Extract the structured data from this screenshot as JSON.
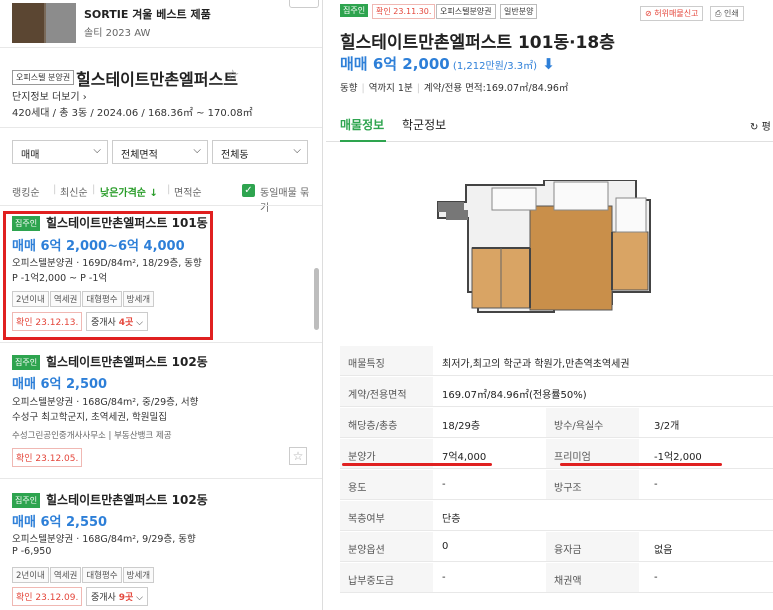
{
  "ad": {
    "title": "SORTIE 겨울 베스트 제품",
    "sub": "솔티 2023 AW"
  },
  "complex": {
    "tag": "오피스텔 분양권",
    "name": "힐스테이트만촌엘퍼스트",
    "link": "단지정보 더보기 ›",
    "info": "420세대 / 총 3동 / 2024.06 / 168.36㎡ ~ 170.08㎡"
  },
  "filters": [
    {
      "label": "매매"
    },
    {
      "label": "전체면적"
    },
    {
      "label": "전체동"
    }
  ],
  "sort": {
    "ranking": "랭킹순",
    "newest": "최신순",
    "lowprice": "낮은가격순 ↓",
    "area": "면적순",
    "group": "동일매물 묶기"
  },
  "listings": [
    {
      "badge": "집주인",
      "name": "힐스테이트만촌엘퍼스트 101동",
      "price": "매매 6억 2,000~6억 4,000",
      "line1": "오피스텔분양권 · 169D/84m², 18/29층, 동향",
      "line2": "P -1억2,000 ~ P -1억",
      "chips": [
        "2년이내",
        "역세권",
        "대형평수",
        "방세개"
      ],
      "confirm": "확인 23.12.13.",
      "agent_pre": "중개사 ",
      "agent_num": "4곳",
      "agent_post": " ⌵"
    },
    {
      "badge": "집주인",
      "name": "힐스테이트만촌엘퍼스트 102동",
      "price": "매매 6억 2,500",
      "line1": "오피스텔분양권 · 168G/84m², 중/29층, 서향",
      "line2": "수성구 최고학군지, 초역세권, 학원밀집",
      "line3": "수성그린공인중개사사무소 | 부동산뱅크 제공",
      "confirm": "확인 23.12.05."
    },
    {
      "badge": "집주인",
      "name": "힐스테이트만촌엘퍼스트 102동",
      "price": "매매 6억 2,550",
      "line1": "오피스텔분양권 · 168G/84m², 9/29층, 동향",
      "line2": "P -6,950",
      "chips": [
        "2년이내",
        "역세권",
        "대형평수",
        "방세개"
      ],
      "confirm": "확인 23.12.09.",
      "agent_pre": "중개사 ",
      "agent_num": "9곳",
      "agent_post": " ⌵"
    }
  ],
  "detail": {
    "badges": {
      "owner": "집주인",
      "confirm": "확인 23.11.30.",
      "type": "오피스텔분양권",
      "kind": "일반분양"
    },
    "report": "허위매물신고",
    "print": "인쇄",
    "title": "힐스테이트만촌엘퍼스트 101동·18층",
    "price": "매매 6억 2,000",
    "price_sub": " (1,212만원/3.3㎡)",
    "meta": [
      "동향",
      "역까지 1분",
      "계약/전용 면적:169.07㎡/84.96㎡"
    ],
    "tabs": [
      "매물정보",
      "학군정보"
    ],
    "refresh": "평",
    "table": [
      {
        "k": "매물특징",
        "v": "최저가,최고의 학군과 학원가,만촌역초역세권"
      },
      {
        "k": "계약/전용면적",
        "v": "169.07㎡/84.96㎡(전용률50%)"
      },
      {
        "k": "해당층/총층",
        "v": "18/29층",
        "k2": "방수/욕실수",
        "v2": "3/2개"
      },
      {
        "k": "분양가",
        "v": "7억4,000",
        "k2": "프리미엄",
        "v2": "-1억2,000"
      },
      {
        "k": "용도",
        "v": "-",
        "k2": "방구조",
        "v2": "-"
      },
      {
        "k": "복층여부",
        "v": "단층"
      },
      {
        "k": "분양옵션",
        "v": "0",
        "k2": "융자금",
        "v2": "없음"
      },
      {
        "k": "납부중도금",
        "v": "-",
        "k2": "채권액",
        "v2": "-"
      }
    ]
  },
  "colors": {
    "accent_green": "#2ea44f",
    "price_blue": "#2d7fd8",
    "confirm_red": "#e4463b",
    "highlight": "#e02020"
  }
}
